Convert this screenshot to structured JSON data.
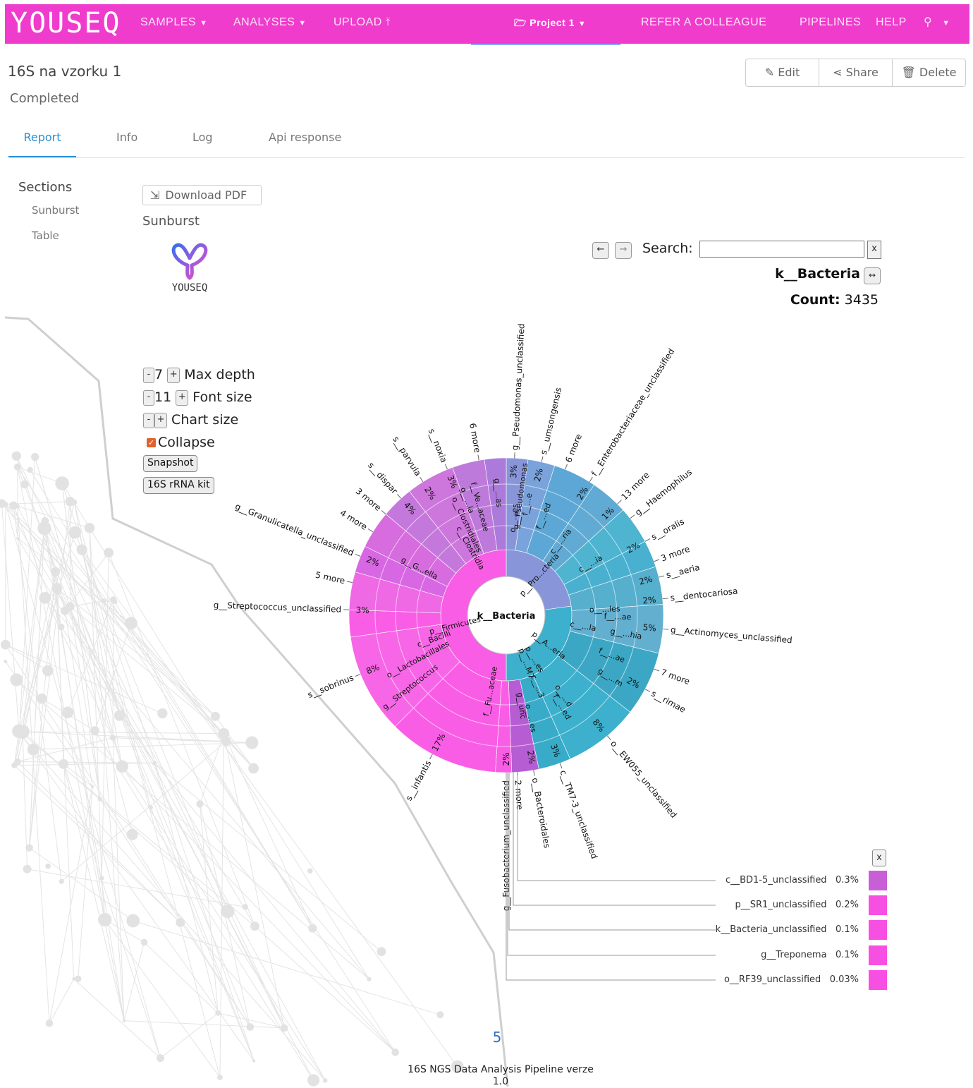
{
  "nav": {
    "brand": "YOUSEQ",
    "samples": "SAMPLES",
    "analyses": "ANALYSES",
    "upload": "UPLOAD",
    "project": "Project 1",
    "refer": "REFER A COLLEAGUE",
    "pipelines": "PIPELINES",
    "help": "HELP",
    "upload_icon": "upload-icon",
    "folder_icon": "folder-icon",
    "user_icon": "user-icon"
  },
  "header": {
    "title": "16S na vzorku 1",
    "status": "Completed",
    "edit": "Edit",
    "share": "Share",
    "delete": "Delete"
  },
  "tabs": [
    "Report",
    "Info",
    "Log",
    "Api response"
  ],
  "sections": {
    "title": "Sections",
    "items": [
      "Sunburst",
      "Table"
    ]
  },
  "report": {
    "download_pdf": "Download PDF",
    "sunburst_title": "Sunburst",
    "logo_text": "YOUSEQ"
  },
  "krona": {
    "search_label": "Search:",
    "search_value": "",
    "search_clear": "x",
    "focus": "k__Bacteria",
    "count_label": "Count:",
    "count_value": "3435",
    "max_depth": {
      "value": "7",
      "label": "Max depth"
    },
    "font_size": {
      "value": "11",
      "label": "Font size"
    },
    "chart_size": {
      "label": "Chart size"
    },
    "collapse": {
      "label": "Collapse",
      "checked": true
    },
    "snapshot": "Snapshot",
    "kit": "16S rRNA kit",
    "legend_close": "x",
    "legend": [
      {
        "name": "c__BD1-5_unclassified",
        "pct": "0.3%",
        "color": "#c95fd6"
      },
      {
        "name": "p__SR1_unclassified",
        "pct": "0.2%",
        "color": "#f84fe3"
      },
      {
        "name": "k__Bacteria_unclassified",
        "pct": "0.1%",
        "color": "#f84fe3"
      },
      {
        "name": "g__Treponema",
        "pct": "0.1%",
        "color": "#f84fe3"
      },
      {
        "name": "o__RF39_unclassified",
        "pct": "0.03%",
        "color": "#f84fe3"
      }
    ]
  },
  "chart_data": {
    "type": "sunburst",
    "center": "k__Bacteria",
    "phyla": [
      {
        "name": "p__Firmicutes",
        "color": "#f84fe3"
      },
      {
        "name": "p__Pro...cteria",
        "color": "#7f8bd8"
      },
      {
        "name": "p__A...eria",
        "color": "#2aa6c6"
      },
      {
        "name": "p__...es",
        "color": "#2aa6c6"
      },
      {
        "name": "p__...M7",
        "color": "#2aa6c6"
      }
    ],
    "inner_labels": [
      "c__Bacilli",
      "o__Lactobacillales",
      "g__Streptococcus",
      "c__Clostridia",
      "o__Clostridiales",
      "f__Ve...aceae",
      "g__...la",
      "g__...as",
      "g__G...ella",
      "g__Pseudomonas",
      "f__...e",
      "f__...ed",
      "o__...es",
      "c__...ria",
      "c__...ia",
      "o__...les",
      "f__...ae",
      "g__...hia",
      "c__...la",
      "f__...ae",
      "g__...m",
      "o__...d",
      "f__Fu...aceae",
      "g__unc",
      "c__...3",
      "f__...ed",
      "o__...es"
    ],
    "outer_labels": [
      {
        "label": "g__Pseudomonas_unclassified",
        "pct": "3%"
      },
      {
        "label": "s__umsongensis",
        "pct": "2%"
      },
      {
        "label": "6 more",
        "pct": ""
      },
      {
        "label": "f__Enterobacteriaceae_unclassified",
        "pct": "2%"
      },
      {
        "label": "13 more",
        "pct": "1%"
      },
      {
        "label": "g__Haemophilus",
        "pct": ""
      },
      {
        "label": "s__oralis",
        "pct": "2%"
      },
      {
        "label": "3 more",
        "pct": ""
      },
      {
        "label": "s__aeria",
        "pct": "2%"
      },
      {
        "label": "s__dentocariosa",
        "pct": "2%"
      },
      {
        "label": "g__Actinomyces_unclassified",
        "pct": "5%"
      },
      {
        "label": "7 more",
        "pct": ""
      },
      {
        "label": "s__rimae",
        "pct": "2%"
      },
      {
        "label": "o__EW055_unclassified",
        "pct": "8%"
      },
      {
        "label": "c__TM7-3_unclassified",
        "pct": "3%"
      },
      {
        "label": "o__Bacteroidales",
        "pct": "2%"
      },
      {
        "label": "2 more",
        "pct": ""
      },
      {
        "label": "g__Fusobacterium_unclassified",
        "pct": "2%"
      },
      {
        "label": "s__infantis",
        "pct": "17%"
      },
      {
        "label": "s__sobrinus",
        "pct": "8%"
      },
      {
        "label": "g__Streptococcus_unclassified",
        "pct": "3%"
      },
      {
        "label": "5 more",
        "pct": ""
      },
      {
        "label": "g__Granulicatella_unclassified",
        "pct": "2%"
      },
      {
        "label": "4 more",
        "pct": ""
      },
      {
        "label": "3 more",
        "pct": ""
      },
      {
        "label": "s__dispar",
        "pct": "4%"
      },
      {
        "label": "s__parvula",
        "pct": "2%"
      },
      {
        "label": "s__noxia",
        "pct": "3%"
      },
      {
        "label": "6 more",
        "pct": ""
      }
    ]
  },
  "footer": {
    "page_number": "5",
    "line1": "16S NGS Data Analysis Pipeline verze",
    "line2": "1.0"
  }
}
